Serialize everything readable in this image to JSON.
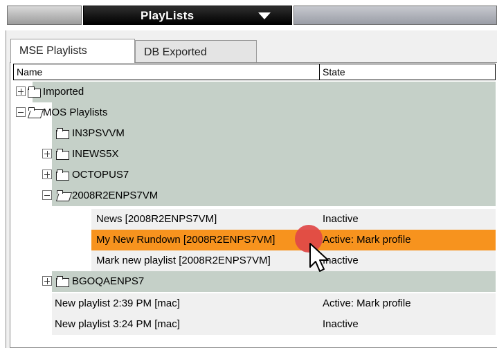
{
  "header": {
    "title": "PlayLists"
  },
  "tabs": [
    {
      "label": "MSE Playlists"
    },
    {
      "label": "DB Exported"
    }
  ],
  "columns": {
    "name": "Name",
    "state": "State"
  },
  "rows": [
    {
      "name": "Imported",
      "state": ""
    },
    {
      "name": "MOS Playlists",
      "state": ""
    },
    {
      "name": "IN3PSVVM",
      "state": ""
    },
    {
      "name": "INEWS5X",
      "state": ""
    },
    {
      "name": "OCTOPUS7",
      "state": ""
    },
    {
      "name": "2008R2ENPS7VM",
      "state": ""
    },
    {
      "name": "News [2008R2ENPS7VM]",
      "state": "Inactive"
    },
    {
      "name": "My New Rundown [2008R2ENPS7VM]",
      "state": "Active: Mark profile"
    },
    {
      "name": "Mark new playlist [2008R2ENPS7VM]",
      "state": "Inactive"
    },
    {
      "name": "BGOQAENPS7",
      "state": ""
    },
    {
      "name": "New playlist 2:39 PM [mac]",
      "state": "Active: Mark profile"
    },
    {
      "name": "New playlist 3:24 PM [mac]",
      "state": "Inactive"
    }
  ],
  "colors": {
    "tree_row_bg": "#c5d0c8",
    "selected_row_bg": "#f7931e",
    "click_indicator": "#e04848"
  },
  "cursor": {
    "icon": "arrow-cursor-icon"
  }
}
